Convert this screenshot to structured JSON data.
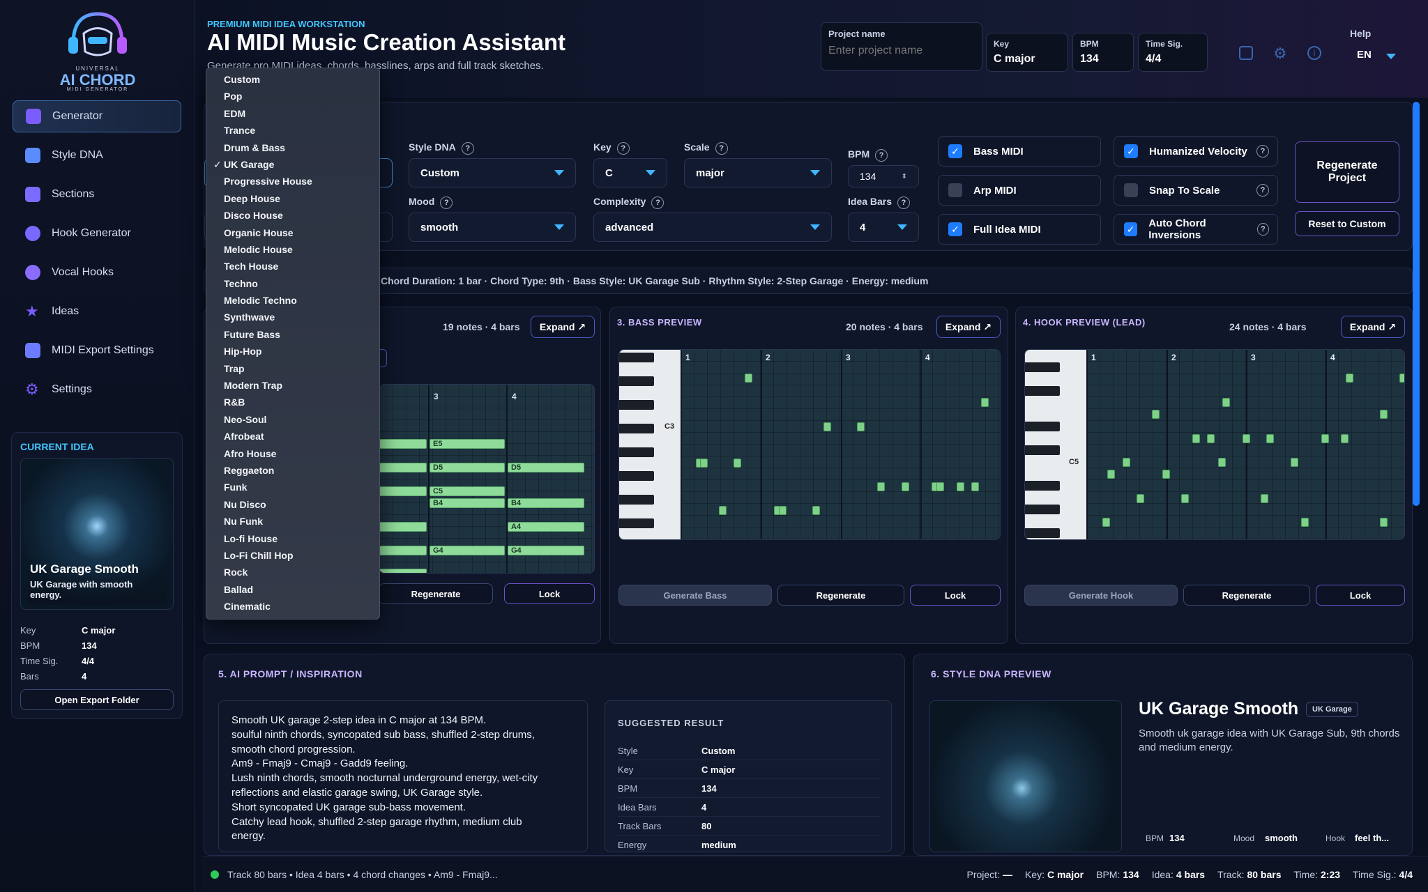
{
  "app": {
    "logo_text": "AI CHORD",
    "logo_top": "UNIVERSAL",
    "logo_bottom": "MIDI GENERATOR"
  },
  "sidebar": {
    "items": [
      {
        "label": "Generator",
        "icon": "generator-icon",
        "color": "#7b5cff"
      },
      {
        "label": "Style DNA",
        "icon": "cube-icon",
        "color": "#5a8cff"
      },
      {
        "label": "Sections",
        "icon": "layers-icon",
        "color": "#7b6cff"
      },
      {
        "label": "Hook Generator",
        "icon": "music-note-icon",
        "color": "#7a68ff"
      },
      {
        "label": "Vocal Hooks",
        "icon": "microphone-icon",
        "color": "#8a6cff"
      },
      {
        "label": "Ideas",
        "icon": "star-icon",
        "color": "#7c5cff"
      },
      {
        "label": "MIDI Export Settings",
        "icon": "download-icon",
        "color": "#6b7cff"
      },
      {
        "label": "Settings",
        "icon": "gear-icon",
        "color": "#7b5cff"
      }
    ],
    "current_idea": {
      "heading": "CURRENT IDEA",
      "title": "UK Garage Smooth",
      "desc": "UK Garage with smooth energy.",
      "key_label": "Key",
      "key": "C major",
      "bpm_label": "BPM",
      "bpm": "134",
      "ts_label": "Time Sig.",
      "ts": "4/4",
      "bars_label": "Bars",
      "bars": "4",
      "button": "Open Export Folder"
    }
  },
  "header": {
    "eyebrow": "PREMIUM MIDI IDEA WORKSTATION",
    "title": "AI MIDI Music Creation Assistant",
    "subtitle": "Generate pro MIDI ideas, chords, basslines, arps and full track sketches.",
    "project_label": "Project name",
    "project_placeholder": "Enter project name",
    "key_label": "Key",
    "key": "C major",
    "bpm_label": "BPM",
    "bpm": "134",
    "ts_label": "Time Sig.",
    "ts": "4/4",
    "help_label": "Help",
    "lang": "EN"
  },
  "controls": {
    "style_dna_label": "Style DNA",
    "style_dna": "Custom",
    "key_label": "Key",
    "key": "C",
    "scale_label": "Scale",
    "scale": "major",
    "bpm_label": "BPM",
    "bpm": "134",
    "mood_label": "Mood",
    "mood": "smooth",
    "complexity_label": "Complexity",
    "complexity": "advanced",
    "idea_bars_label": "Idea Bars",
    "idea_bars": "4",
    "checks": [
      {
        "label": "Bass MIDI",
        "on": true
      },
      {
        "label": "Arp MIDI",
        "on": false
      },
      {
        "label": "Full Idea MIDI",
        "on": true
      },
      {
        "label": "Humanized Velocity",
        "on": true
      },
      {
        "label": "Snap To Scale",
        "on": false
      },
      {
        "label": "Auto Chord Inversions",
        "on": true
      }
    ],
    "regenerate_project": "Regenerate Project",
    "reset": "Reset to Custom",
    "summary": "Chord Duration: 1 bar · Chord Type: 9th · Bass Style: UK Garage Sub · Rhythm Style: 2-Step Garage · Energy: medium"
  },
  "chords_panel": {
    "meta": "19 notes · 4 bars",
    "expand": "Expand ↗",
    "regenerate": "Regenerate",
    "lock": "Lock",
    "bars": [
      "3",
      "4"
    ],
    "notes": [
      {
        "label": "E5"
      },
      {
        "label": "D5"
      },
      {
        "label": "D5"
      },
      {
        "label": "C5"
      },
      {
        "label": "B4"
      },
      {
        "label": "B4"
      },
      {
        "label": "A4"
      },
      {
        "label": "G4"
      },
      {
        "label": "G4"
      }
    ]
  },
  "bass_panel": {
    "title": "3. BASS PREVIEW",
    "meta": "20 notes · 4 bars",
    "expand": "Expand ↗",
    "generate": "Generate Bass",
    "regenerate": "Regenerate",
    "lock": "Lock",
    "key_label": "C3",
    "bars": [
      "1",
      "2",
      "3",
      "4"
    ]
  },
  "hook_panel": {
    "title": "4. HOOK PREVIEW (LEAD)",
    "meta": "24 notes · 4 bars",
    "expand": "Expand ↗",
    "generate": "Generate Hook",
    "regenerate": "Regenerate",
    "lock": "Lock",
    "key_label": "C5",
    "bars": [
      "1",
      "2",
      "3",
      "4"
    ]
  },
  "prompt_panel": {
    "title": "5. AI PROMPT / INSPIRATION",
    "lines": [
      "Smooth UK garage 2-step idea in C major at 134 BPM.",
      "soulful ninth chords, syncopated sub bass, shuffled 2-step drums,",
      "smooth chord progression.",
      "Am9 - Fmaj9 - Cmaj9 - Gadd9 feeling.",
      "Lush ninth chords, smooth nocturnal underground energy, wet-city",
      "reflections and elastic garage swing, UK Garage style.",
      "Short syncopated UK garage sub-bass movement.",
      "Catchy lead hook, shuffled 2-step garage rhythm, medium club",
      "energy."
    ],
    "suggested_title": "SUGGESTED RESULT",
    "rows": [
      {
        "k": "Style",
        "v": "Custom"
      },
      {
        "k": "Key",
        "v": "C major"
      },
      {
        "k": "BPM",
        "v": "134"
      },
      {
        "k": "Idea Bars",
        "v": "4"
      },
      {
        "k": "Track Bars",
        "v": "80"
      },
      {
        "k": "Energy",
        "v": "medium"
      }
    ]
  },
  "style_panel": {
    "title": "6. STYLE DNA PREVIEW",
    "name": "UK Garage Smooth",
    "badge": "UK Garage",
    "desc": "Smooth uk garage idea with UK Garage Sub, 9th chords and medium energy.",
    "bpm_label": "BPM",
    "bpm": "134",
    "mood_label": "Mood",
    "mood": "smooth",
    "hook_label": "Hook",
    "hook": "feel th..."
  },
  "dropdown": {
    "selected": "UK Garage",
    "options": [
      "Custom",
      "Pop",
      "EDM",
      "Trance",
      "Drum & Bass",
      "UK Garage",
      "Progressive House",
      "Deep House",
      "Disco House",
      "Organic House",
      "Melodic House",
      "Tech House",
      "Techno",
      "Melodic Techno",
      "Synthwave",
      "Future Bass",
      "Hip-Hop",
      "Trap",
      "Modern Trap",
      "R&B",
      "Neo-Soul",
      "Afrobeat",
      "Afro House",
      "Reggaeton",
      "Funk",
      "Nu Disco",
      "Nu Funk",
      "Lo-fi House",
      "Lo-Fi Chill Hop",
      "Rock",
      "Ballad",
      "Cinematic"
    ]
  },
  "footer": {
    "left": "Track 80 bars • Idea 4 bars • 4 chord changes • Am9 - Fmaj9...",
    "project_label": "Project:",
    "project": "—",
    "key_label": "Key:",
    "key": "C major",
    "bpm_label": "BPM:",
    "bpm": "134",
    "idea_label": "Idea:",
    "idea": "4 bars",
    "track_label": "Track:",
    "track": "80 bars",
    "time_label": "Time:",
    "time": "2:23",
    "ts_label": "Time Sig.:",
    "ts": "4/4"
  }
}
